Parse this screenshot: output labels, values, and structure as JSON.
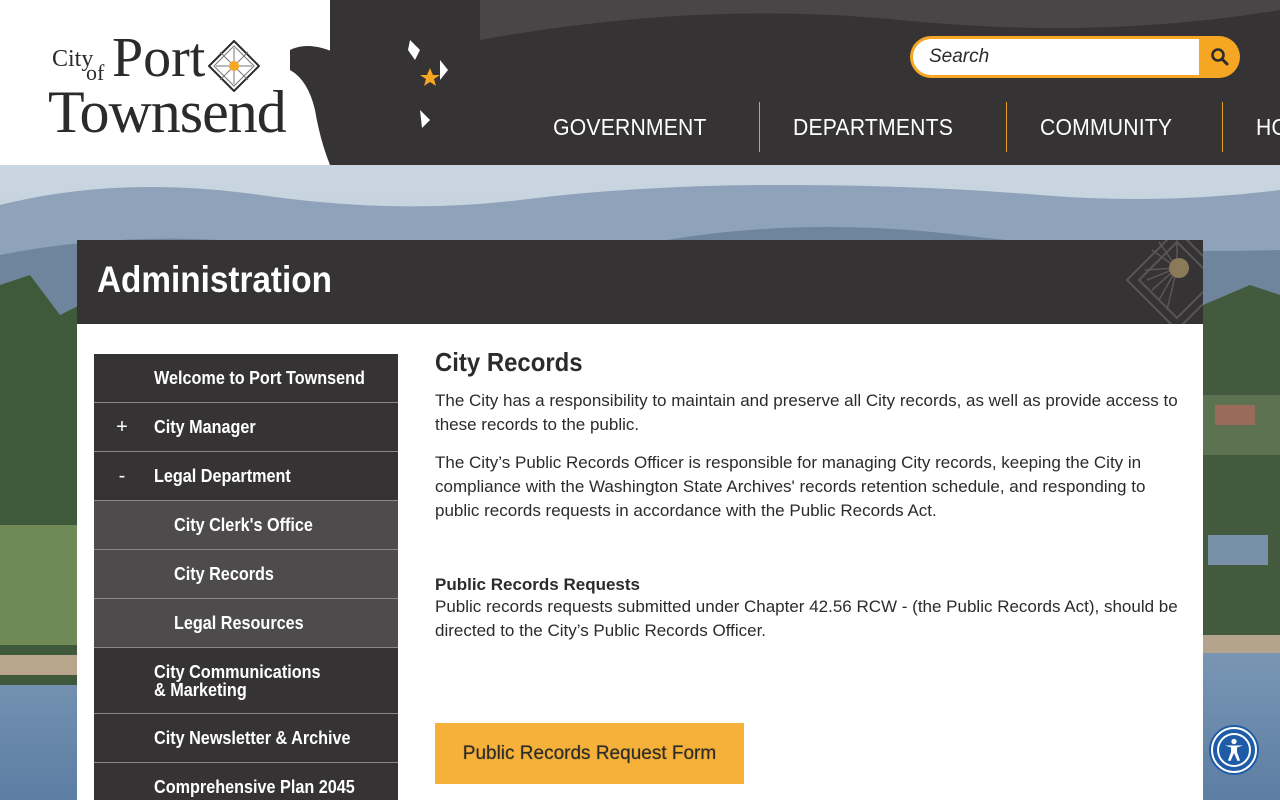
{
  "brand": {
    "logo_city": "City",
    "logo_of": "of",
    "logo_port": "Port",
    "logo_townsend": "Townsend"
  },
  "search": {
    "placeholder": "Search",
    "icon": "search-icon"
  },
  "nav": {
    "items": [
      {
        "label": "GOVERNMENT"
      },
      {
        "label": "DEPARTMENTS"
      },
      {
        "label": "COMMUNITY"
      },
      {
        "label": "HOW DO I"
      }
    ]
  },
  "page": {
    "section_title": "Administration"
  },
  "sidebar": {
    "items": [
      {
        "label": "Welcome to Port Townsend",
        "toggle": ""
      },
      {
        "label": "City Manager",
        "toggle": "+"
      },
      {
        "label": "Legal Department",
        "toggle": "-"
      },
      {
        "label": "City Clerk's Office"
      },
      {
        "label": "City Records"
      },
      {
        "label": "Legal Resources"
      },
      {
        "label": "City Communications & Marketing"
      },
      {
        "label": "City Newsletter & Archive"
      },
      {
        "label": "Comprehensive Plan 2045"
      }
    ]
  },
  "content": {
    "heading": "City Records",
    "para1": "The City has a responsibility to maintain and preserve all City records, as well as provide access to these records to the public.",
    "para2": "The City’s Public Records Officer is responsible for managing City records, keeping the City in compliance with the Washington State Archives' records retention schedule, and responding to public records requests in accordance with the Public Records Act.",
    "subheading": "Public Records Requests",
    "para3": "Public records requests submitted under Chapter 42.56 RCW - (the Public Records Act), should be directed to the City’s Public Records Officer.",
    "cta_label": "Public Records Request Form"
  },
  "colors": {
    "header_dark": "#363334",
    "accent": "#f5a623",
    "subnav": "#4e4b4c",
    "a11y_blue": "#1f5ca8"
  },
  "icons": {
    "accessibility": "accessibility-icon",
    "brand_mark": "sun-diamond-icon",
    "location": "star-icon"
  }
}
